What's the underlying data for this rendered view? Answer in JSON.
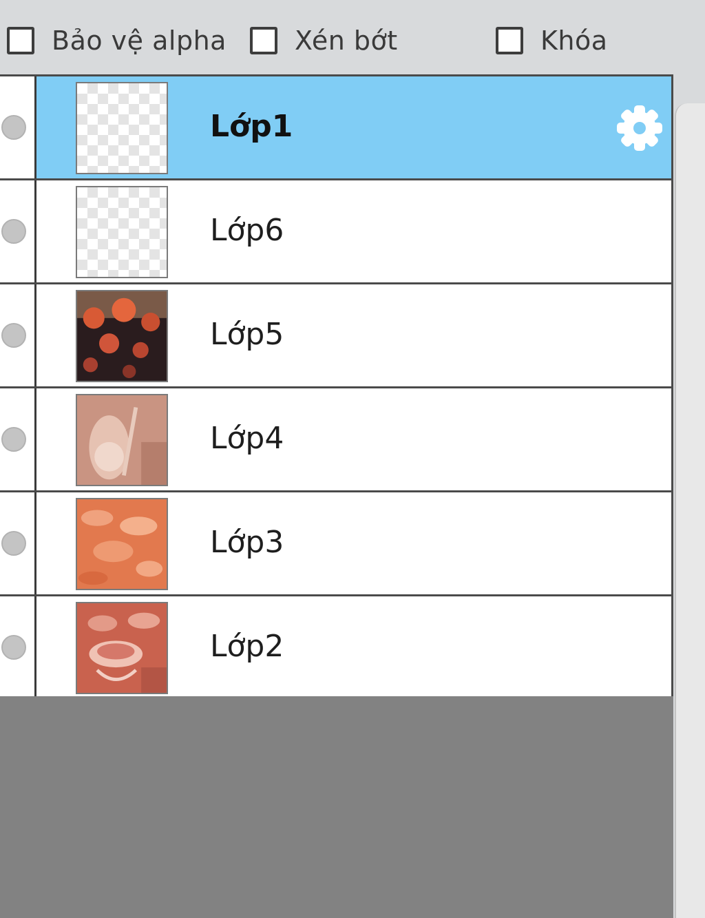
{
  "options": {
    "alpha_protect": {
      "label": "Bảo vệ alpha",
      "checked": false
    },
    "clip": {
      "label": "Xén bớt",
      "checked": false
    },
    "lock": {
      "label": "Khóa",
      "checked": false
    }
  },
  "layers": [
    {
      "name": "Lớp1",
      "selected": true,
      "thumbnail": "transparent"
    },
    {
      "name": "Lớp6",
      "selected": false,
      "thumbnail": "transparent"
    },
    {
      "name": "Lớp5",
      "selected": false,
      "thumbnail": "dark-flowers-photo"
    },
    {
      "name": "Lớp4",
      "selected": false,
      "thumbnail": "peach-shoes-photo"
    },
    {
      "name": "Lớp3",
      "selected": false,
      "thumbnail": "orange-petals-photo"
    },
    {
      "name": "Lớp2",
      "selected": false,
      "thumbnail": "coral-teacups-photo"
    }
  ],
  "colors": {
    "selected_row": "#80cdf5",
    "panel_background": "#d8dadc",
    "empty_area": "#828282"
  },
  "icons": {
    "layer_settings": "gear-icon"
  }
}
